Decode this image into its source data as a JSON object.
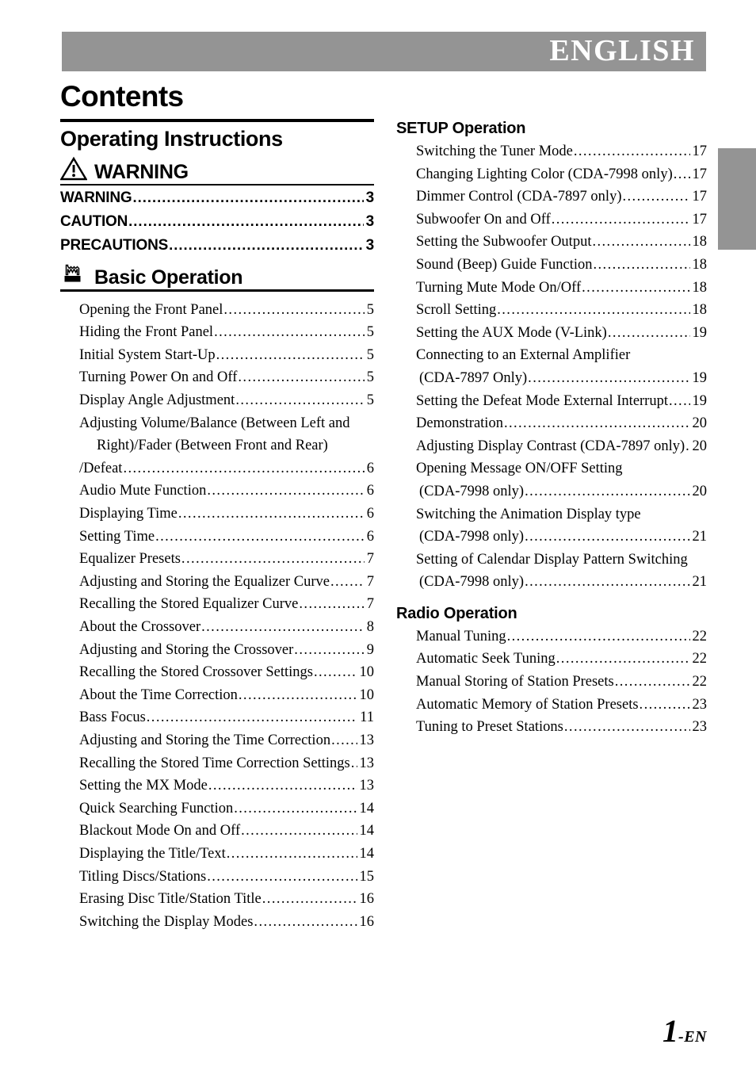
{
  "header": {
    "language_label": "ENGLISH",
    "bar_color": "#949494"
  },
  "edge_tab": {
    "color": "#949494"
  },
  "page_title": "Contents",
  "footer": {
    "page_number": "1",
    "page_suffix": "-EN"
  },
  "left_column": {
    "section_title": "Operating Instructions",
    "warning_section": {
      "heading": "WARNING",
      "icon": "warning-triangle-icon",
      "entries": [
        {
          "label": "WARNING",
          "page": "3"
        },
        {
          "label": "CAUTION",
          "page": "3"
        },
        {
          "label": "PRECAUTIONS",
          "page": "3"
        }
      ]
    },
    "basic_section": {
      "heading": "Basic Operation",
      "icon": "pointing-hand-icon",
      "entries": [
        {
          "label": "Opening the Front Panel",
          "page": "5"
        },
        {
          "label": "Hiding the Front Panel",
          "page": "5"
        },
        {
          "label": "Initial System Start-Up",
          "page": "5"
        },
        {
          "label": "Turning Power On and Off",
          "page": "5"
        },
        {
          "label": "Display Angle Adjustment",
          "page": "5"
        },
        {
          "label": "Adjusting Volume/Balance (Between Left and",
          "continuation": [
            "Right)/Fader (Between Front and Rear)"
          ],
          "last_line": "/Defeat",
          "page": "6"
        },
        {
          "label": "Audio Mute Function",
          "page": "6"
        },
        {
          "label": "Displaying Time",
          "page": "6"
        },
        {
          "label": "Setting Time",
          "page": "6"
        },
        {
          "label": "Equalizer Presets",
          "page": "7"
        },
        {
          "label": "Adjusting and Storing the Equalizer Curve",
          "page": "7"
        },
        {
          "label": "Recalling the Stored Equalizer Curve",
          "page": "7"
        },
        {
          "label": "About the Crossover",
          "page": "8"
        },
        {
          "label": "Adjusting and Storing the Crossover",
          "page": "9"
        },
        {
          "label": "Recalling the Stored Crossover Settings",
          "page": "10"
        },
        {
          "label": "About the Time Correction",
          "page": "10"
        },
        {
          "label": "Bass Focus",
          "page": "11"
        },
        {
          "label": "Adjusting and Storing the Time Correction",
          "page": "13"
        },
        {
          "label": "Recalling the Stored Time Correction Settings",
          "page": "13"
        },
        {
          "label": "Setting the MX Mode",
          "page": "13"
        },
        {
          "label": "Quick Searching Function",
          "page": "14"
        },
        {
          "label": "Blackout Mode On and Off",
          "page": "14"
        },
        {
          "label": "Displaying the Title/Text",
          "page": "14"
        },
        {
          "label": "Titling Discs/Stations",
          "page": "15"
        },
        {
          "label": "Erasing Disc Title/Station Title",
          "page": "16"
        },
        {
          "label": "Switching the Display Modes",
          "page": "16"
        }
      ]
    }
  },
  "right_column": {
    "setup_section": {
      "heading": "SETUP Operation",
      "entries": [
        {
          "label": "Switching the Tuner Mode",
          "page": "17"
        },
        {
          "label": "Changing Lighting Color (CDA-7998 only)",
          "page": "17"
        },
        {
          "label": "Dimmer Control (CDA-7897 only)",
          "page": "17"
        },
        {
          "label": "Subwoofer On and Off",
          "page": "17"
        },
        {
          "label": "Setting the Subwoofer Output",
          "page": "18"
        },
        {
          "label": "Sound (Beep) Guide Function",
          "page": "18"
        },
        {
          "label": "Turning Mute Mode On/Off",
          "page": "18"
        },
        {
          "label": "Scroll Setting",
          "page": "18"
        },
        {
          "label": "Setting the AUX Mode (V-Link)",
          "page": "19"
        },
        {
          "label": "Connecting to an External Amplifier",
          "last_line": "(CDA-7897 Only)",
          "page": "19"
        },
        {
          "label": "Setting the Defeat Mode External Interrupt",
          "page": "19"
        },
        {
          "label": "Demonstration",
          "page": "20"
        },
        {
          "label": "Adjusting Display Contrast (CDA-7897 only)",
          "page": "20"
        },
        {
          "label": "Opening Message ON/OFF Setting",
          "last_line": "(CDA-7998 only)",
          "page": "20"
        },
        {
          "label": "Switching the Animation Display type",
          "last_line": "(CDA-7998 only)",
          "page": "21"
        },
        {
          "label": "Setting of Calendar Display Pattern Switching",
          "last_line": "(CDA-7998 only)",
          "page": "21"
        }
      ]
    },
    "radio_section": {
      "heading": "Radio Operation",
      "entries": [
        {
          "label": "Manual Tuning",
          "page": "22"
        },
        {
          "label": "Automatic Seek Tuning",
          "page": "22"
        },
        {
          "label": "Manual Storing of Station Presets",
          "page": "22"
        },
        {
          "label": "Automatic Memory of Station Presets",
          "page": "23"
        },
        {
          "label": "Tuning to Preset Stations",
          "page": "23"
        }
      ]
    }
  },
  "leader_dots": "......................................................................................................"
}
